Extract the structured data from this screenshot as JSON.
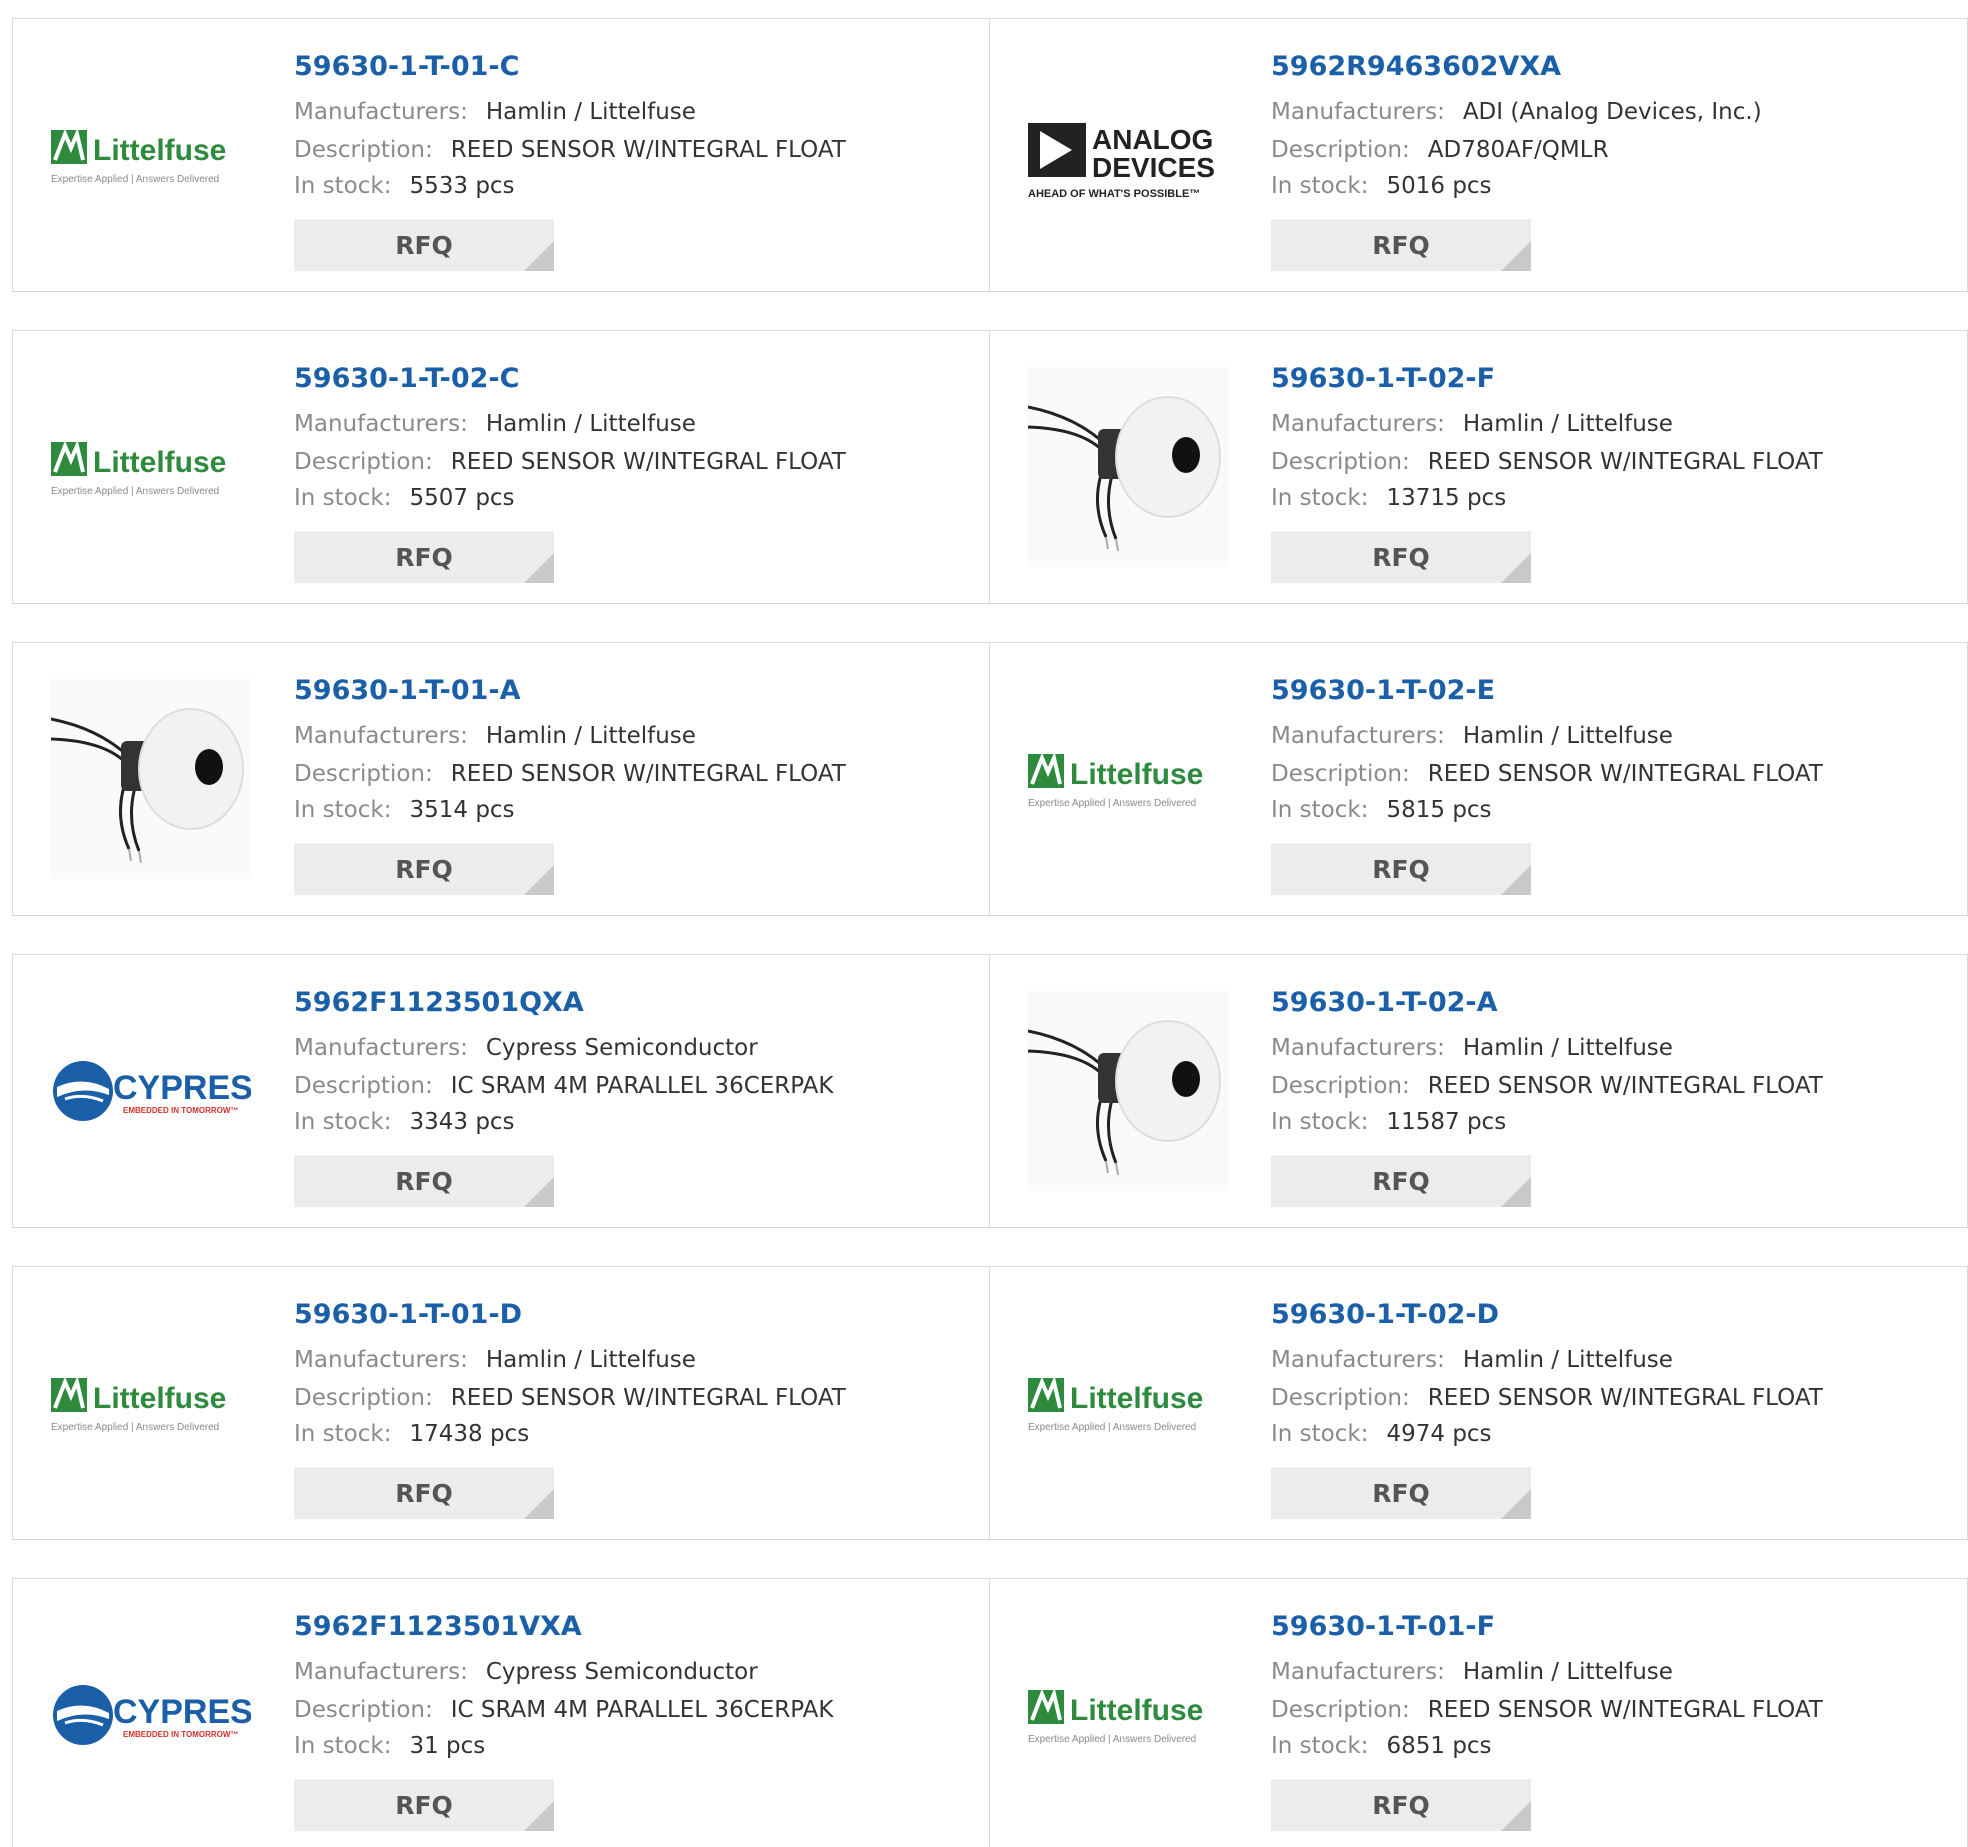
{
  "labels": {
    "manufacturers": "Manufacturers:",
    "description": "Description:",
    "stock": "In stock:",
    "rfq": "RFQ"
  },
  "logos": {
    "littelfuse": {
      "name": "Littelfuse",
      "tagline": "Expertise Applied | Answers Delivered",
      "color": "#2e8b3e"
    },
    "adi": {
      "name_line1": "ANALOG",
      "name_line2": "DEVICES",
      "tagline": "AHEAD OF WHAT'S POSSIBLE™"
    },
    "cypress": {
      "name": "CYPRESS",
      "tagline": "EMBEDDED IN TOMORROW™",
      "color": "#1a5fa8",
      "accent": "#d0342c"
    }
  },
  "products": [
    {
      "part": "59630-1-T-01-C",
      "manufacturer": "Hamlin / Littelfuse",
      "description": "REED SENSOR W/INTEGRAL FLOAT",
      "stock": "5533 pcs",
      "image": "littelfuse-logo"
    },
    {
      "part": "5962R9463602VXA",
      "manufacturer": "ADI (Analog Devices, Inc.)",
      "description": "AD780AF/QMLR",
      "stock": "5016 pcs",
      "image": "adi-logo"
    },
    {
      "part": "59630-1-T-02-C",
      "manufacturer": "Hamlin / Littelfuse",
      "description": "REED SENSOR W/INTEGRAL FLOAT",
      "stock": "5507 pcs",
      "image": "littelfuse-logo"
    },
    {
      "part": "59630-1-T-02-F",
      "manufacturer": "Hamlin / Littelfuse",
      "description": "REED SENSOR W/INTEGRAL FLOAT",
      "stock": "13715 pcs",
      "image": "float-sensor-photo"
    },
    {
      "part": "59630-1-T-01-A",
      "manufacturer": "Hamlin / Littelfuse",
      "description": "REED SENSOR W/INTEGRAL FLOAT",
      "stock": "3514 pcs",
      "image": "float-sensor-photo"
    },
    {
      "part": "59630-1-T-02-E",
      "manufacturer": "Hamlin / Littelfuse",
      "description": "REED SENSOR W/INTEGRAL FLOAT",
      "stock": "5815 pcs",
      "image": "littelfuse-logo"
    },
    {
      "part": "5962F1123501QXA",
      "manufacturer": "Cypress Semiconductor",
      "description": "IC SRAM 4M PARALLEL 36CERPAK",
      "stock": "3343 pcs",
      "image": "cypress-logo"
    },
    {
      "part": "59630-1-T-02-A",
      "manufacturer": "Hamlin / Littelfuse",
      "description": "REED SENSOR W/INTEGRAL FLOAT",
      "stock": "11587 pcs",
      "image": "float-sensor-photo"
    },
    {
      "part": "59630-1-T-01-D",
      "manufacturer": "Hamlin / Littelfuse",
      "description": "REED SENSOR W/INTEGRAL FLOAT",
      "stock": "17438 pcs",
      "image": "littelfuse-logo"
    },
    {
      "part": "59630-1-T-02-D",
      "manufacturer": "Hamlin / Littelfuse",
      "description": "REED SENSOR W/INTEGRAL FLOAT",
      "stock": "4974 pcs",
      "image": "littelfuse-logo"
    },
    {
      "part": "5962F1123501VXA",
      "manufacturer": "Cypress Semiconductor",
      "description": "IC SRAM 4M PARALLEL 36CERPAK",
      "stock": "31 pcs",
      "image": "cypress-logo"
    },
    {
      "part": "59630-1-T-01-F",
      "manufacturer": "Hamlin / Littelfuse",
      "description": "REED SENSOR W/INTEGRAL FLOAT",
      "stock": "6851 pcs",
      "image": "littelfuse-logo"
    }
  ]
}
